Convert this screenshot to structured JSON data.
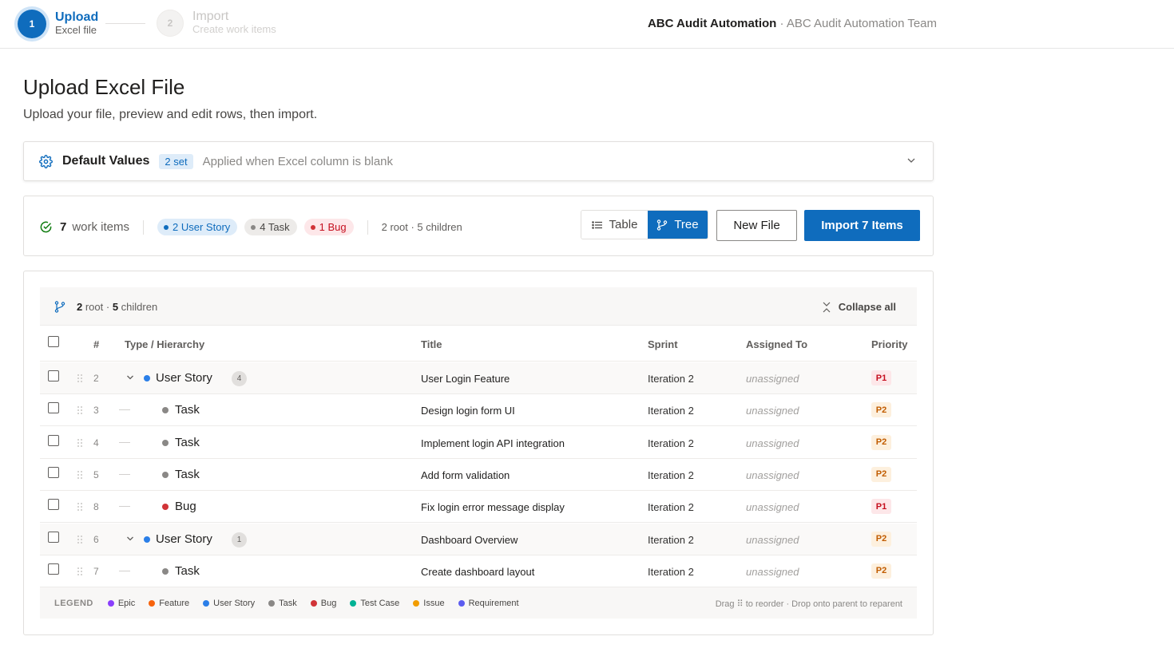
{
  "wizard": {
    "steps": [
      {
        "number": "1",
        "title": "Upload",
        "subtitle": "Excel file"
      },
      {
        "number": "2",
        "title": "Import",
        "subtitle": "Create work items"
      }
    ]
  },
  "org": {
    "name": "ABC Audit Automation",
    "team": " · ABC Audit Automation Team"
  },
  "header": {
    "title": "Upload Excel File",
    "subtitle": "Upload your file, preview and edit rows, then import."
  },
  "defaults": {
    "title": "Default Values",
    "badge": "2 set",
    "hint": "Applied when Excel column is blank"
  },
  "summary": {
    "count": "7",
    "count_label": "work items",
    "pills": [
      {
        "label": "2 User Story",
        "kind": "story"
      },
      {
        "label": "4 Task",
        "kind": "task"
      },
      {
        "label": "1 Bug",
        "kind": "bug"
      }
    ],
    "root_info": "2 root · 5 children",
    "view_table": "Table",
    "view_tree": "Tree",
    "new_file": "New File",
    "import": "Import 7 Items"
  },
  "tree": {
    "head_root": "2",
    "head_root_label": " root · ",
    "head_children": "5",
    "head_children_label": " children",
    "collapse_all": "Collapse all",
    "columns": {
      "num": "#",
      "type": "Type / Hierarchy",
      "title": "Title",
      "sprint": "Sprint",
      "assigned": "Assigned To",
      "priority": "Priority"
    },
    "rows": [
      {
        "num": "2",
        "type": "User Story",
        "parent": true,
        "children": "4",
        "title": "User Login Feature",
        "sprint": "Iteration 2",
        "assigned": "unassigned",
        "priority": "P1"
      },
      {
        "num": "3",
        "type": "Task",
        "parent": false,
        "title": "Design login form UI",
        "sprint": "Iteration 2",
        "assigned": "unassigned",
        "priority": "P2"
      },
      {
        "num": "4",
        "type": "Task",
        "parent": false,
        "title": "Implement login API integration",
        "sprint": "Iteration 2",
        "assigned": "unassigned",
        "priority": "P2"
      },
      {
        "num": "5",
        "type": "Task",
        "parent": false,
        "title": "Add form validation",
        "sprint": "Iteration 2",
        "assigned": "unassigned",
        "priority": "P2"
      },
      {
        "num": "8",
        "type": "Bug",
        "parent": false,
        "title": "Fix login error message display",
        "sprint": "Iteration 2",
        "assigned": "unassigned",
        "priority": "P1"
      },
      {
        "num": "6",
        "type": "User Story",
        "parent": true,
        "children": "1",
        "title": "Dashboard Overview",
        "sprint": "Iteration 2",
        "assigned": "unassigned",
        "priority": "P2"
      },
      {
        "num": "7",
        "type": "Task",
        "parent": false,
        "title": "Create dashboard layout",
        "sprint": "Iteration 2",
        "assigned": "unassigned",
        "priority": "P2"
      }
    ],
    "legend_title": "LEGEND",
    "legend": [
      {
        "label": "Epic",
        "color": "#8a3ffc"
      },
      {
        "label": "Feature",
        "color": "#f7630c"
      },
      {
        "label": "User Story",
        "color": "#2b7fe8"
      },
      {
        "label": "Task",
        "color": "#8a8886"
      },
      {
        "label": "Bug",
        "color": "#d13438"
      },
      {
        "label": "Test Case",
        "color": "#00b294"
      },
      {
        "label": "Issue",
        "color": "#f29d00"
      },
      {
        "label": "Requirement",
        "color": "#5c5cf0"
      }
    ],
    "legend_hint": "Drag ⠿ to reorder · Drop onto parent to reparent"
  },
  "colors": {
    "accent": "#0f6cbd",
    "story": "#2b7fe8",
    "task": "#8a8886",
    "bug": "#d13438"
  }
}
